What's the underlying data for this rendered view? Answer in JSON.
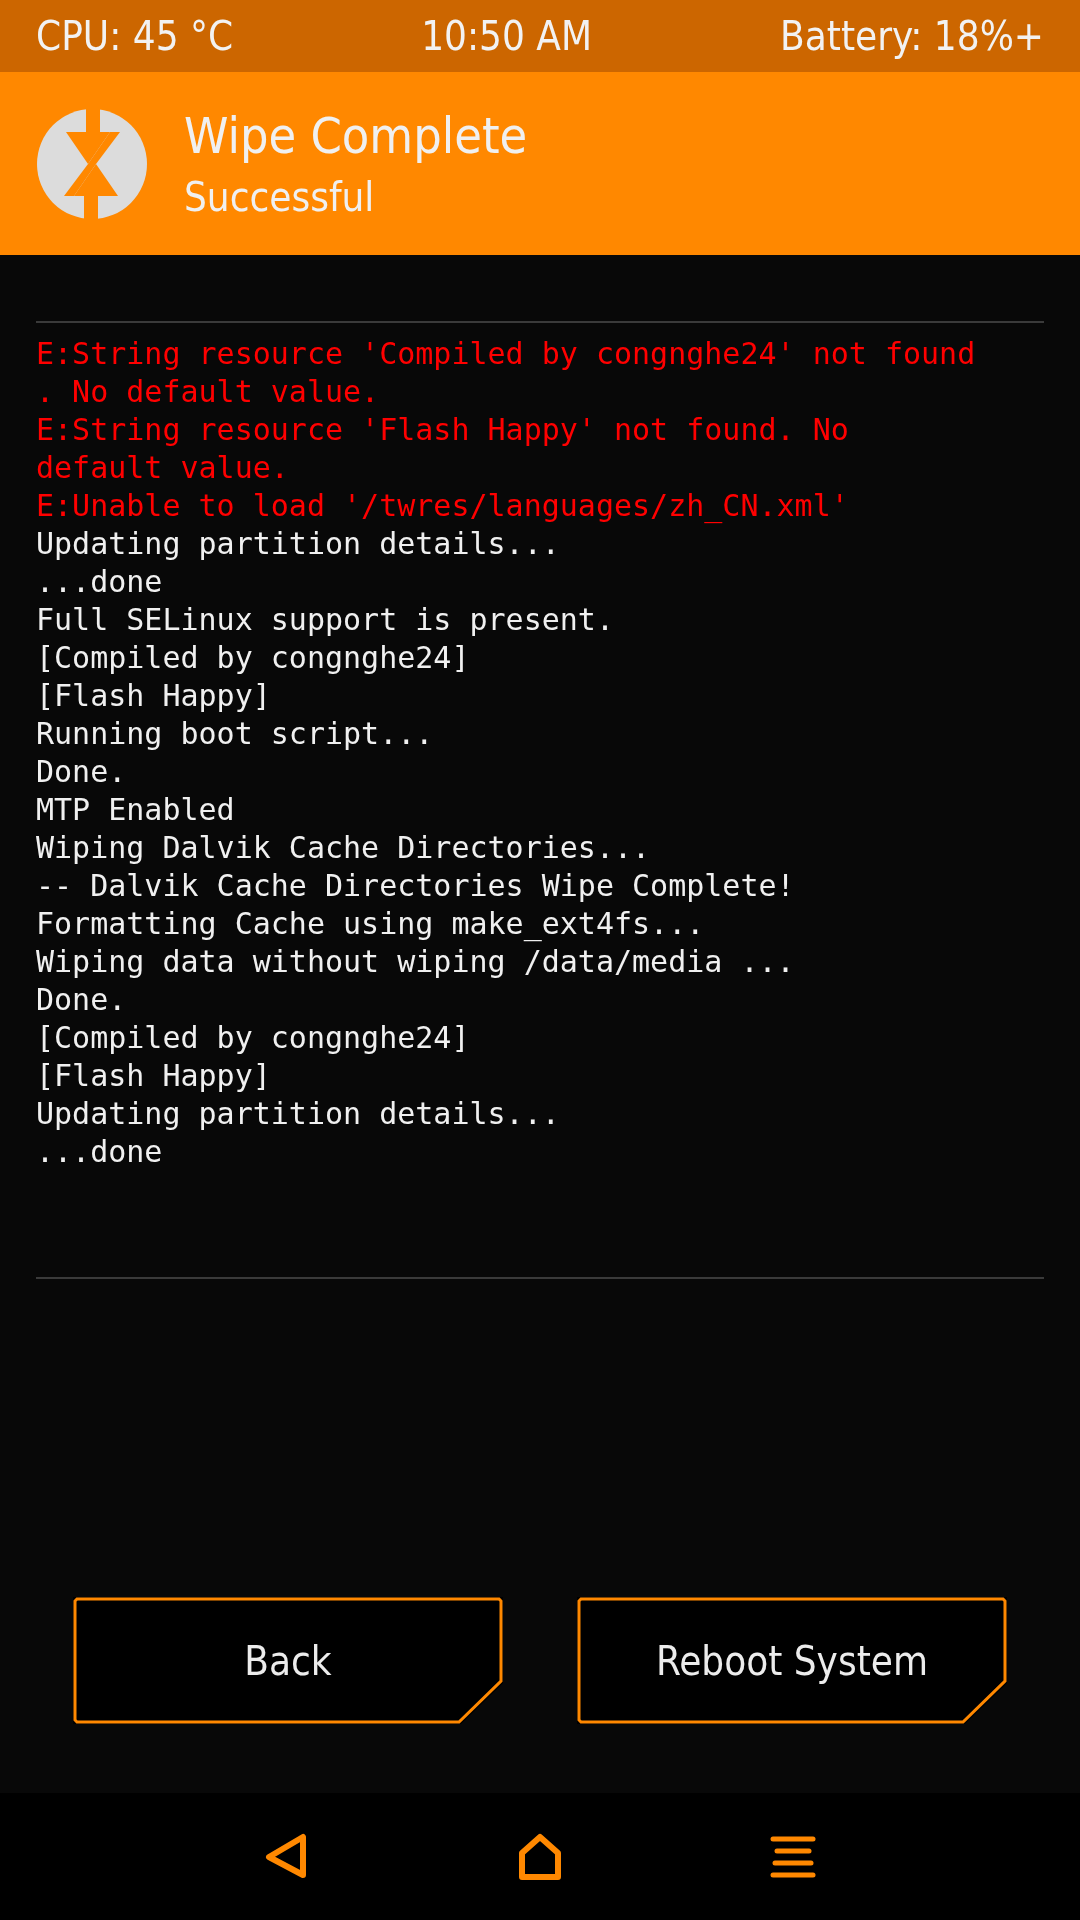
{
  "status_bar": {
    "cpu": "CPU: 45 °C",
    "time": "10:50 AM",
    "battery": "Battery: 18%+"
  },
  "header": {
    "title": "Wipe Complete",
    "subtitle": "Successful"
  },
  "console": [
    {
      "kind": "error",
      "text": "E:String resource 'Compiled by congnghe24' not found"
    },
    {
      "kind": "error",
      "text": ". No default value."
    },
    {
      "kind": "error",
      "text": "E:String resource 'Flash Happy' not found. No"
    },
    {
      "kind": "error",
      "text": "default value."
    },
    {
      "kind": "error",
      "text": "E:Unable to load '/twres/languages/zh_CN.xml'"
    },
    {
      "kind": "info",
      "text": "Updating partition details..."
    },
    {
      "kind": "info",
      "text": "...done"
    },
    {
      "kind": "info",
      "text": "Full SELinux support is present."
    },
    {
      "kind": "info",
      "text": "[Compiled by congnghe24]"
    },
    {
      "kind": "info",
      "text": "[Flash Happy]"
    },
    {
      "kind": "info",
      "text": "Running boot script..."
    },
    {
      "kind": "info",
      "text": "Done."
    },
    {
      "kind": "info",
      "text": "MTP Enabled"
    },
    {
      "kind": "info",
      "text": "Wiping Dalvik Cache Directories..."
    },
    {
      "kind": "info",
      "text": "-- Dalvik Cache Directories Wipe Complete!"
    },
    {
      "kind": "info",
      "text": "Formatting Cache using make_ext4fs..."
    },
    {
      "kind": "info",
      "text": "Wiping data without wiping /data/media ..."
    },
    {
      "kind": "info",
      "text": "Done."
    },
    {
      "kind": "info",
      "text": "[Compiled by congnghe24]"
    },
    {
      "kind": "info",
      "text": "[Flash Happy]"
    },
    {
      "kind": "info",
      "text": "Updating partition details..."
    },
    {
      "kind": "info",
      "text": "...done"
    }
  ],
  "buttons": [
    {
      "label": "Back"
    },
    {
      "label": "Reboot System"
    }
  ],
  "nav_bar": [
    {
      "kind": "back"
    },
    {
      "kind": "home"
    },
    {
      "kind": "menu"
    }
  ]
}
